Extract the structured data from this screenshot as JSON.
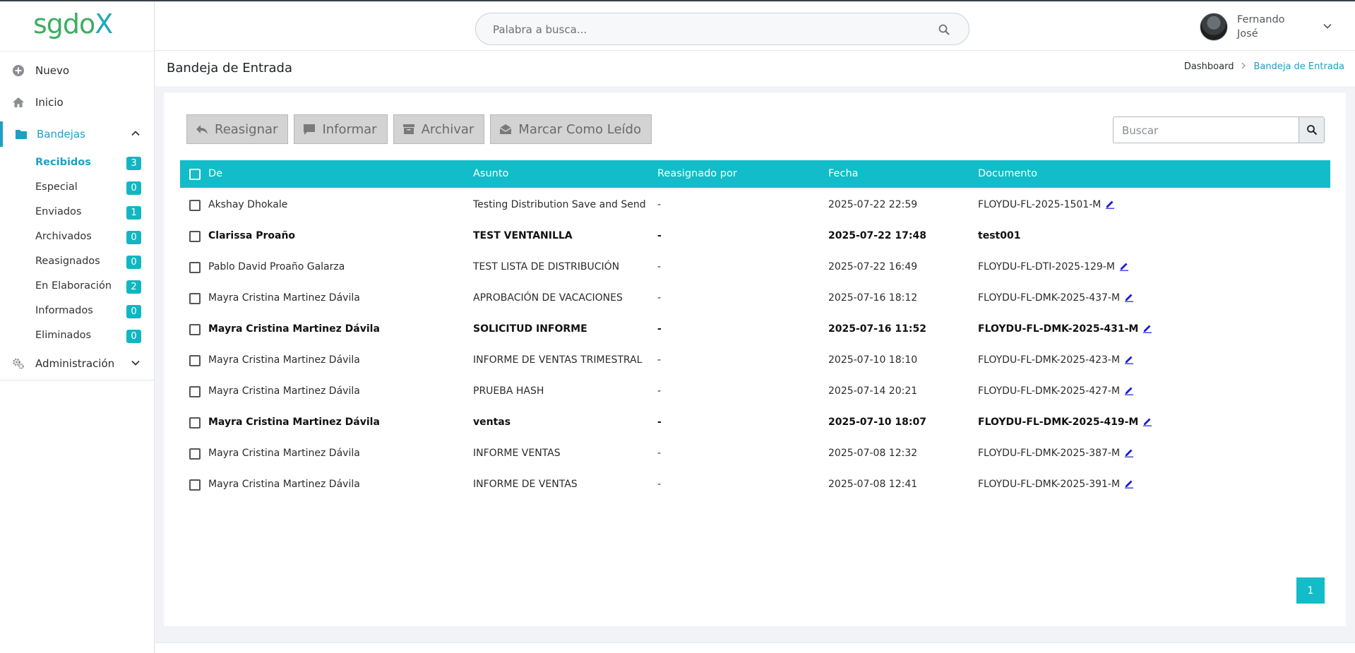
{
  "app": {
    "logo_text_a": "sgdo",
    "logo_text_b": "X"
  },
  "header": {
    "search_placeholder": "Palabra a busca...",
    "user_first": "Fernando",
    "user_last": "José"
  },
  "sidebar": {
    "nuevo": "Nuevo",
    "inicio": "Inicio",
    "bandejas": "Bandejas",
    "administracion": "Administración",
    "subitems": [
      {
        "label": "Recibidos",
        "count": "3"
      },
      {
        "label": "Especial",
        "count": "0"
      },
      {
        "label": "Enviados",
        "count": "1"
      },
      {
        "label": "Archivados",
        "count": "0"
      },
      {
        "label": "Reasignados",
        "count": "0"
      },
      {
        "label": "En Elaboración",
        "count": "2"
      },
      {
        "label": "Informados",
        "count": "0"
      },
      {
        "label": "Eliminados",
        "count": "0"
      }
    ]
  },
  "page": {
    "title": "Bandeja de Entrada",
    "breadcrumb": [
      "Dashboard",
      "Bandeja de Entrada"
    ]
  },
  "toolbar": {
    "reasignar": "Reasignar",
    "informar": "Informar",
    "archivar": "Archivar",
    "marcar": "Marcar Como Leído",
    "search_placeholder": "Buscar"
  },
  "table": {
    "headers": [
      "De",
      "Asunto",
      "Reasignado por",
      "Fecha",
      "Documento"
    ],
    "rows": [
      {
        "de": "Akshay Dhokale",
        "asunto": "Testing Distribution Save and Send",
        "reasignado": "-",
        "fecha": "2025-07-22 22:59",
        "documento": "FLOYDU-FL-2025-1501-M",
        "unread": false,
        "edit": true
      },
      {
        "de": "Clarissa Proaño",
        "asunto": "TEST VENTANILLA",
        "reasignado": "-",
        "fecha": "2025-07-22 17:48",
        "documento": "test001",
        "unread": true,
        "edit": false
      },
      {
        "de": "Pablo David Proaño Galarza",
        "asunto": "TEST LISTA DE DISTRIBUCIÓN",
        "reasignado": "-",
        "fecha": "2025-07-22 16:49",
        "documento": "FLOYDU-FL-DTI-2025-129-M",
        "unread": false,
        "edit": true
      },
      {
        "de": "Mayra Cristina Martinez Dávila",
        "asunto": "APROBACIÓN DE VACACIONES",
        "reasignado": "-",
        "fecha": "2025-07-16 18:12",
        "documento": "FLOYDU-FL-DMK-2025-437-M",
        "unread": false,
        "edit": true
      },
      {
        "de": "Mayra Cristina Martinez Dávila",
        "asunto": "SOLICITUD INFORME",
        "reasignado": "-",
        "fecha": "2025-07-16 11:52",
        "documento": "FLOYDU-FL-DMK-2025-431-M",
        "unread": true,
        "edit": true
      },
      {
        "de": "Mayra Cristina Martinez Dávila",
        "asunto": "INFORME DE VENTAS TRIMESTRAL",
        "reasignado": "-",
        "fecha": "2025-07-10 18:10",
        "documento": "FLOYDU-FL-DMK-2025-423-M",
        "unread": false,
        "edit": true
      },
      {
        "de": "Mayra Cristina Martinez Dávila",
        "asunto": "PRUEBA HASH",
        "reasignado": "-",
        "fecha": "2025-07-14 20:21",
        "documento": "FLOYDU-FL-DMK-2025-427-M",
        "unread": false,
        "edit": true
      },
      {
        "de": "Mayra Cristina Martinez Dávila",
        "asunto": "ventas",
        "reasignado": "-",
        "fecha": "2025-07-10 18:07",
        "documento": "FLOYDU-FL-DMK-2025-419-M",
        "unread": true,
        "edit": true
      },
      {
        "de": "Mayra Cristina Martinez Dávila",
        "asunto": "INFORME VENTAS",
        "reasignado": "-",
        "fecha": "2025-07-08 12:32",
        "documento": "FLOYDU-FL-DMK-2025-387-M",
        "unread": false,
        "edit": true
      },
      {
        "de": "Mayra Cristina Martinez Dávila",
        "asunto": "INFORME DE VENTAS",
        "reasignado": "-",
        "fecha": "2025-07-08 12:41",
        "documento": "FLOYDU-FL-DMK-2025-391-M",
        "unread": false,
        "edit": true
      }
    ]
  },
  "pagination": {
    "current": "1"
  },
  "colors": {
    "accent": "#12bcc8",
    "link": "#1f9fc4"
  }
}
